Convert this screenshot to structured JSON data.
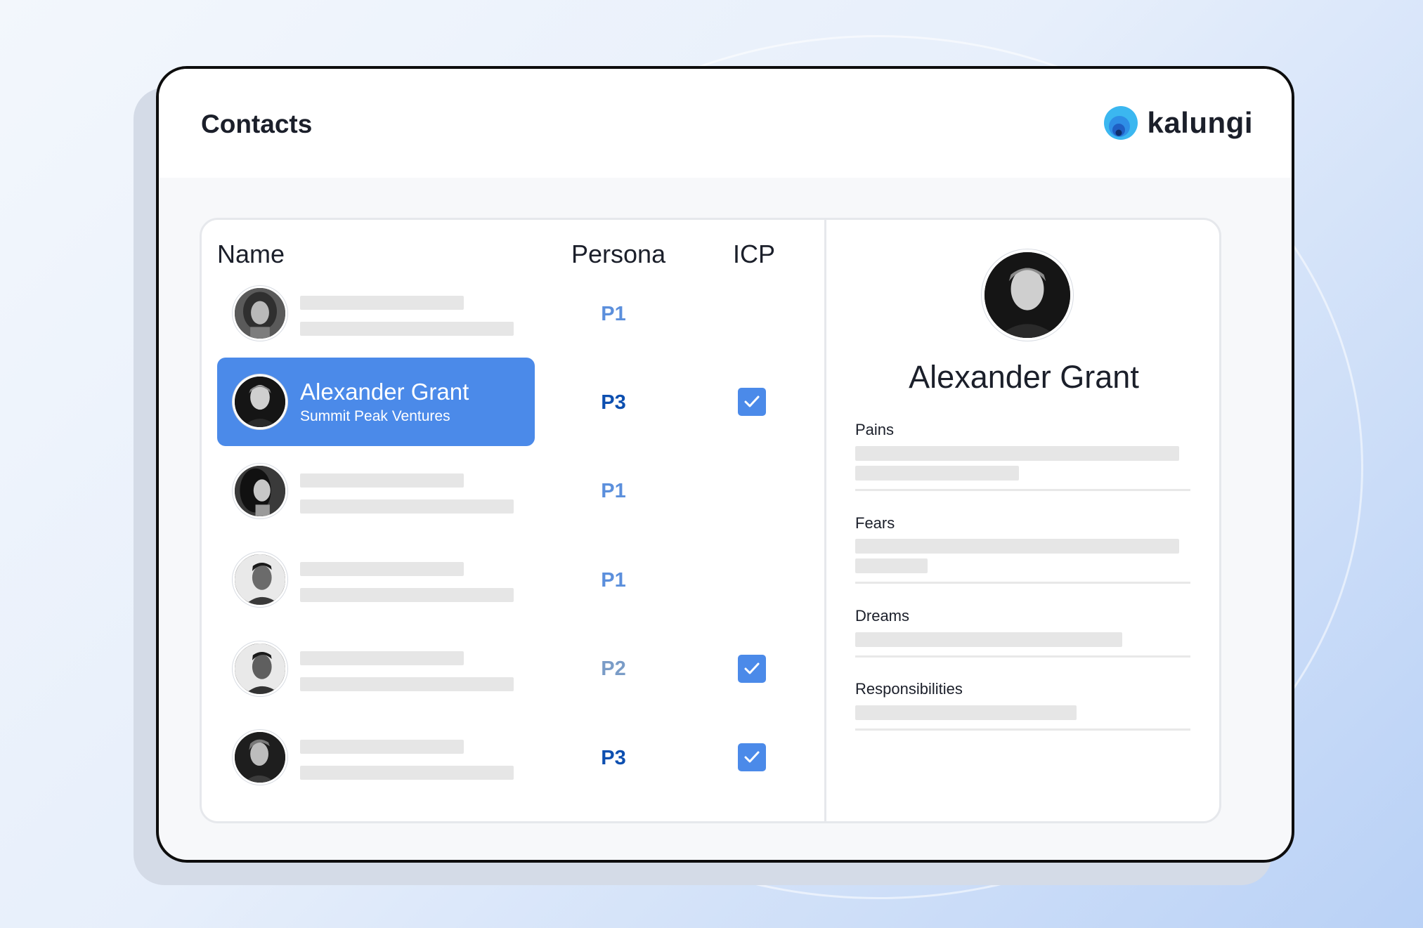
{
  "page": {
    "title": "Contacts"
  },
  "brand": {
    "name": "kalungi"
  },
  "table": {
    "headers": {
      "name": "Name",
      "persona": "Persona",
      "icp": "ICP"
    },
    "rows": [
      {
        "persona": "P1",
        "icp": false,
        "selected": false
      },
      {
        "name": "Alexander Grant",
        "company": "Summit Peak Ventures",
        "persona": "P3",
        "icp": true,
        "selected": true
      },
      {
        "persona": "P1",
        "icp": false,
        "selected": false
      },
      {
        "persona": "P1",
        "icp": false,
        "selected": false
      },
      {
        "persona": "P2",
        "icp": true,
        "selected": false
      },
      {
        "persona": "P3",
        "icp": true,
        "selected": false
      }
    ]
  },
  "detail": {
    "name": "Alexander Grant",
    "fields": [
      {
        "label": "Pains"
      },
      {
        "label": "Fears"
      },
      {
        "label": "Dreams"
      },
      {
        "label": "Responsibilities"
      }
    ]
  },
  "icons": {
    "brand": "kalungi-logo-icon",
    "check": "checkmark-icon",
    "avatar": "user-avatar-icon"
  },
  "colors": {
    "accent": "#4b8ae9",
    "persona_light": "#5b8fdc",
    "persona_dark": "#0d4fb0",
    "placeholder": "#e6e6e6"
  }
}
